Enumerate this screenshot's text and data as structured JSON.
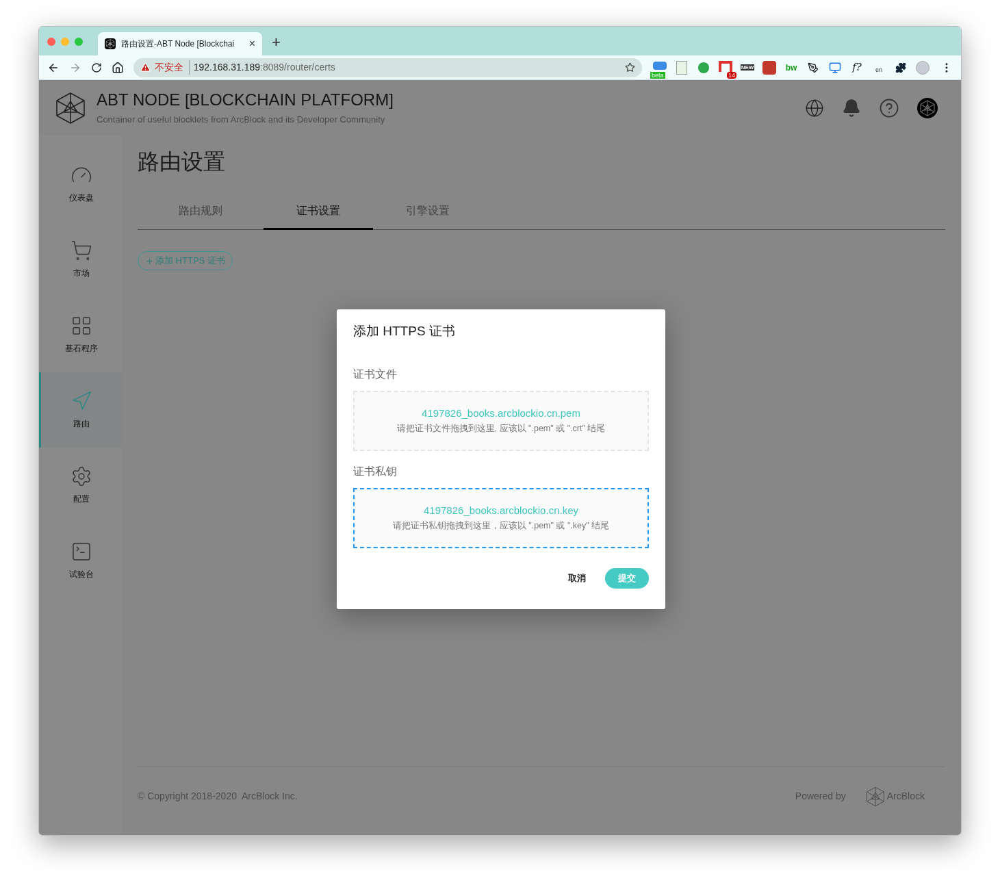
{
  "browser": {
    "tab": {
      "title": "路由设置-ABT Node [Blockchai",
      "close": "×"
    },
    "new_tab": "+",
    "security": "不安全",
    "url_host": "192.168.31.189",
    "url_path": ":8089/router/certs",
    "extensions": [
      {
        "kind": "beta",
        "label": "beta"
      },
      {
        "kind": "sheet"
      },
      {
        "kind": "elephant"
      },
      {
        "kind": "mail",
        "label": "14"
      },
      {
        "kind": "new",
        "label": "NEW"
      },
      {
        "kind": "red"
      },
      {
        "kind": "bw",
        "label": "bw"
      },
      {
        "kind": "pen"
      },
      {
        "kind": "monitor"
      },
      {
        "kind": "f",
        "label": "f?"
      },
      {
        "kind": "translate",
        "label": "en"
      },
      {
        "kind": "puzzle"
      },
      {
        "kind": "avatar"
      }
    ]
  },
  "header": {
    "title": "ABT NODE [BLOCKCHAIN PLATFORM]",
    "subtitle": "Container of useful blocklets from ArcBlock and its Developer Community"
  },
  "sidebar": {
    "items": [
      {
        "label": "仪表盘",
        "selected": false
      },
      {
        "label": "市场",
        "selected": false
      },
      {
        "label": "基石程序",
        "selected": false
      },
      {
        "label": "路由",
        "selected": true
      },
      {
        "label": "配置",
        "selected": false
      },
      {
        "label": "试验台",
        "selected": false
      }
    ]
  },
  "page": {
    "title": "路由设置",
    "tabs": [
      {
        "label": "路由规则",
        "selected": false
      },
      {
        "label": "证书设置",
        "selected": true
      },
      {
        "label": "引擎设置",
        "selected": false
      }
    ],
    "add_button": "添加 HTTPS 证书"
  },
  "dialog": {
    "title": "添加 HTTPS 证书",
    "fields": [
      {
        "label": "证书文件",
        "file": "4197826_books.arcblockio.cn.pem",
        "hint": "请把证书文件拖拽到这里, 应该以 \".pem\" 或 \".crt\" 结尾",
        "focused": false
      },
      {
        "label": "证书私钥",
        "file": "4197826_books.arcblockio.cn.key",
        "hint": "请把证书私钥拖拽到这里，应该以 \".pem\" 或 \".key\" 结尾",
        "focused": true
      }
    ],
    "cancel": "取消",
    "submit": "提交"
  },
  "footer": {
    "copyright": "© Copyright 2018-2020  ArcBlock Inc.",
    "powered_by": "Powered by",
    "brand": "ArcBlock"
  }
}
